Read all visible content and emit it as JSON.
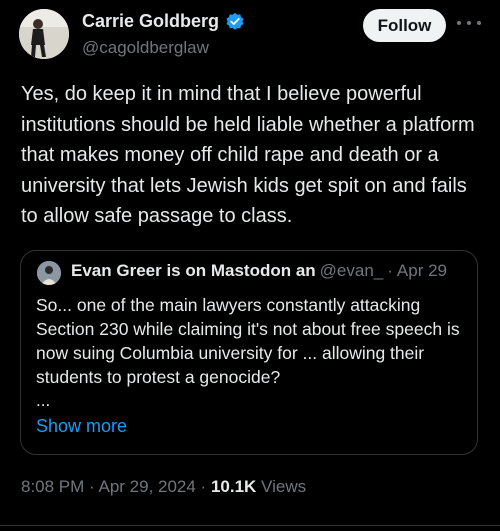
{
  "author": {
    "name": "Carrie Goldberg",
    "handle": "@cagoldberglaw"
  },
  "follow_label": "Follow",
  "tweet_text": "Yes, do keep it in mind that I believe powerful institutions should be held liable whether a platform that makes money off child rape and death or a university that lets Jewish kids get spit on and fails to allow safe passage to class.",
  "quote": {
    "name": "Evan Greer is on Mastodon an",
    "handle": "@evan_",
    "separator": "·",
    "date": "Apr 29",
    "text": "So... one of the main lawyers constantly attacking Section 230 while claiming it's not about free speech is now suing Columbia university for ... allowing their students to protest a genocide?",
    "ellipsis": "...",
    "show_more": "Show more"
  },
  "meta": {
    "time_date": "8:08 PM · Apr 29, 2024 · ",
    "views_count": "10.1K",
    "views_label": " Views"
  },
  "colors": {
    "background": "#000000",
    "text": "#e7e9ea",
    "secondary": "#71767b",
    "link": "#1d9bf0",
    "verified": "#1d9bf0",
    "border": "#2f3336"
  }
}
